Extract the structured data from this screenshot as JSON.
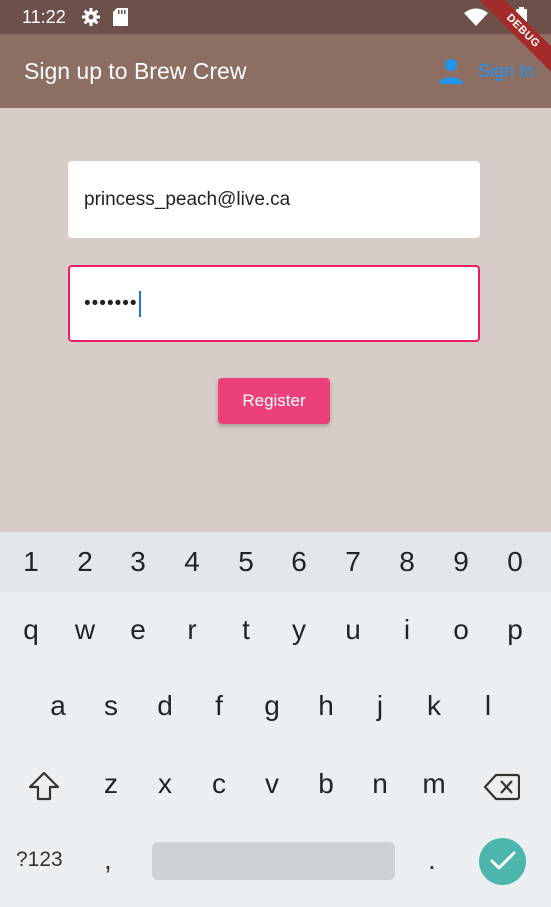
{
  "status_bar": {
    "time": "11:22"
  },
  "debug_banner": "DEBUG",
  "app_bar": {
    "title": "Sign up to Brew Crew",
    "sign_in_label": "Sign In",
    "icon": "person-icon"
  },
  "form": {
    "email_value": "princess_peach@live.ca",
    "password_masked": "•••••••",
    "register_label": "Register"
  },
  "keyboard": {
    "number_row": [
      "1",
      "2",
      "3",
      "4",
      "5",
      "6",
      "7",
      "8",
      "9",
      "0"
    ],
    "row1": [
      "q",
      "w",
      "e",
      "r",
      "t",
      "y",
      "u",
      "i",
      "o",
      "p"
    ],
    "row2": [
      "a",
      "s",
      "d",
      "f",
      "g",
      "h",
      "j",
      "k",
      "l"
    ],
    "row3": [
      "z",
      "x",
      "c",
      "v",
      "b",
      "n",
      "m"
    ],
    "symbols_label": "?123",
    "comma": ",",
    "period": ".",
    "icons": [
      "shift-icon",
      "backspace-icon",
      "checkmark-icon"
    ]
  },
  "colors": {
    "app_bar": "#8d6e63",
    "status_bar": "#6d5049",
    "background": "#d7ccc8",
    "accent": "#e91e63",
    "register_button": "#ec407a",
    "sign_in": "#2196f3",
    "done_key": "#4db6ac"
  }
}
